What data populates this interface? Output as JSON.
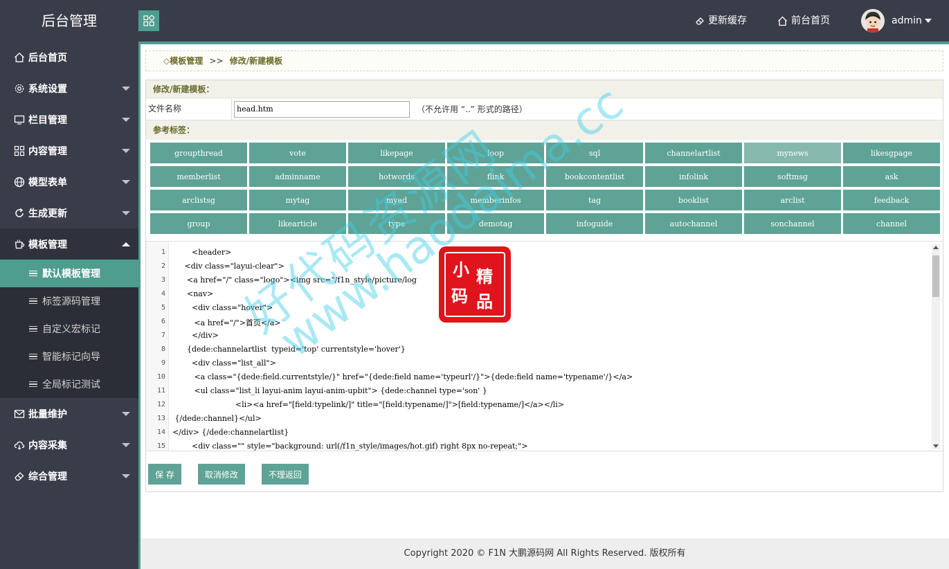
{
  "header": {
    "logo": "后台管理",
    "update_cache": "更新缓存",
    "front_home": "前台首页",
    "user": "admin"
  },
  "sidebar": {
    "items": [
      {
        "label": "后台首页",
        "icon": "home-icon"
      },
      {
        "label": "系统设置",
        "icon": "gear-icon"
      },
      {
        "label": "栏目管理",
        "icon": "monitor-icon"
      },
      {
        "label": "内容管理",
        "icon": "apps-icon"
      },
      {
        "label": "模型表单",
        "icon": "globe-icon"
      },
      {
        "label": "生成更新",
        "icon": "refresh-icon"
      },
      {
        "label": "模板管理",
        "icon": "cup-icon"
      },
      {
        "label": "批量维护",
        "icon": "mail-icon"
      },
      {
        "label": "内容采集",
        "icon": "cloud-icon"
      },
      {
        "label": "综合管理",
        "icon": "eraser-icon"
      }
    ],
    "sub_items": [
      "默认模板管理",
      "标签源码管理",
      "自定义宏标记",
      "智能标记向导",
      "全局标记测试"
    ]
  },
  "breadcrumb": {
    "prefix": "◇模板管理",
    "sep": ">>",
    "current": "修改/新建模板"
  },
  "form": {
    "title": "修改/新建模板：",
    "file_label": "文件名称",
    "file_value": "head.htm",
    "file_note": "（不允许用 “..” 形式的路径）",
    "ref_title": "参考标签："
  },
  "tags": [
    "groupthread",
    "vote",
    "likepage",
    "loop",
    "sql",
    "channelartlist",
    "mynews",
    "likesgpage",
    "memberlist",
    "adminname",
    "hotwords",
    "flink",
    "bookcontentlist",
    "infolink",
    "softmsg",
    "ask",
    "arclistsg",
    "mytag",
    "myad",
    "memberinfos",
    "tag",
    "booklist",
    "arclist",
    "feedback",
    "group",
    "likearticle",
    "type",
    "demotag",
    "infoguide",
    "autochannel",
    "sonchannel",
    "channel"
  ],
  "code": {
    "line_numbers": [
      "1",
      "2",
      "3",
      "4",
      "5",
      "6",
      "7",
      "8",
      "9",
      "10",
      "11",
      "12",
      "13",
      "14",
      "15"
    ],
    "lines": [
      "        <header>",
      "     <div class=\"layui-clear\">",
      "      <a href=\"/\" class=\"logo\"><img src=\"/f1n_style/picture/log",
      "      <nav>",
      "        <div class=\"hover\">",
      "         <a href=\"/\">首页</a>",
      "        </div>",
      "      {dede:channelartlist  typeid='top' currentstyle='hover'}",
      "        <div class=\"list_all\">",
      "         <a class=\"{dede:field.currentstyle/}\" href=\"{dede:field name='typeurl'/}\">{dede:field name='typename'/}</a>",
      "         <ul class=\"list_li layui-anim layui-anim-upbit\"> {dede:channel type='son' }",
      "                          <li><a href=\"[field:typelink/]\" title=\"[field:typename/]\">[field:typename/]</a></li>",
      " {/dede:channel}</ul>",
      "</div> {/dede:channelartlist}",
      "        <div class=\"\" style=\"background: url(/f1n_style/images/hot.gif) right 8px no-repeat;\">"
    ]
  },
  "buttons": {
    "save": "保 存",
    "cancel": "取消修改",
    "back": "不理返回"
  },
  "footer": "Copyright 2020 © F1N 大鹏源码网 All Rights Reserved. 版权所有",
  "watermark": {
    "stamp": [
      "小",
      "精",
      "码",
      "品"
    ],
    "text1": "好代码资源网",
    "text2": "www.haodaima.cc"
  },
  "colors": {
    "sidebar_bg": "#393d49",
    "accent": "#4e9d8e",
    "tag_bg": "#5ea395"
  }
}
